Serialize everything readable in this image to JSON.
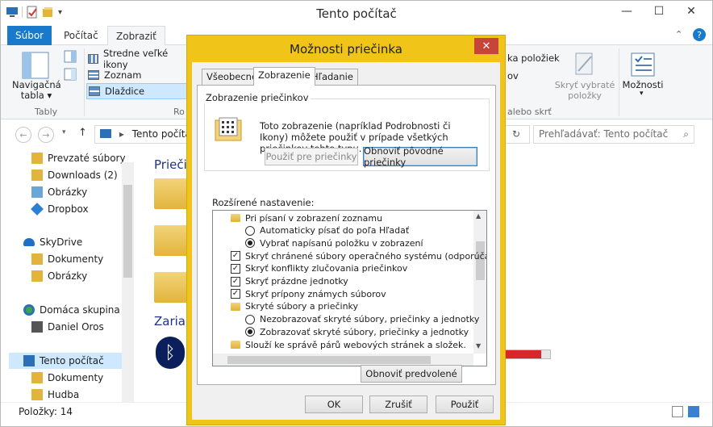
{
  "window": {
    "title": "Tento počítač",
    "tabs": {
      "file": "Súbor",
      "computer": "Počítač",
      "view": "Zobraziť"
    },
    "capbuttons": {
      "minimize": "—",
      "maximize": "☐",
      "close": "✕"
    }
  },
  "ribbon": {
    "layouts": [
      "Stredne veľké ikony",
      "Zoznam",
      "Dlaždice"
    ],
    "nav_pane_label": "Navigačná tabla ▾",
    "panes_group": "Tably",
    "layout_group_partial": "Ro",
    "right_partial1": "ka položiek",
    "right_partial2": "ov",
    "right_partial3": "alebo skrť",
    "hide_selected": "Skryť vybraté položky",
    "options": "Možnosti",
    "options_arrow": "▾",
    "help": "?",
    "chevron": "⌃"
  },
  "address": {
    "path": "Tento počítač",
    "search_placeholder": "Prehľadávať: Tento počítač"
  },
  "nav": {
    "items": [
      "Prevzaté súbory",
      "Downloads (2)",
      "Obrázky",
      "Dropbox",
      "SkyDrive",
      "Dokumenty",
      "Obrázky",
      "Domáca skupina",
      "Daniel Oros",
      "Tento počítač",
      "Dokumenty",
      "Hudba"
    ]
  },
  "content": {
    "folders_heading": "Priečin",
    "devices_heading": "Zariad"
  },
  "status": {
    "items": "Položky: 14"
  },
  "dialog": {
    "title": "Možnosti priečinka",
    "close": "✕",
    "tabs": [
      "Všeobecné",
      "Zobrazenie",
      "Hľadanie"
    ],
    "folder_views": {
      "title": "Zobrazenie priečinkov",
      "text": "Toto zobrazenie (napríklad Podrobnosti či Ikony) môžete použiť v prípade všetkých priečinkov tohto typu.",
      "apply_button": "Použiť pre priečinky",
      "reset_button": "Obnoviť pôvodné priečinky"
    },
    "advanced_label": "Rozšírené nastavenie:",
    "advanced_items": [
      {
        "kind": "folder",
        "text": "Pri písaní v zobrazení zoznamu",
        "indent": 0
      },
      {
        "kind": "radio",
        "checked": false,
        "text": "Automaticky písať do poľa Hľadať",
        "indent": 1
      },
      {
        "kind": "radio",
        "checked": true,
        "text": "Vybrať napísanú položku v zobrazení",
        "indent": 1
      },
      {
        "kind": "check",
        "checked": true,
        "text": "Skryť chránené súbory operačného systému (odporúča sa)",
        "indent": 0
      },
      {
        "kind": "check",
        "checked": true,
        "text": "Skryť konflikty zlučovania priečinkov",
        "indent": 0
      },
      {
        "kind": "check",
        "checked": true,
        "text": "Skryť prázdne jednotky",
        "indent": 0
      },
      {
        "kind": "check",
        "checked": true,
        "text": "Skryť prípony známych súborov",
        "indent": 0
      },
      {
        "kind": "folder",
        "text": "Skryté súbory a priečinky",
        "indent": 0
      },
      {
        "kind": "radio",
        "checked": false,
        "text": "Nezobrazovať skryté súbory, priečinky a jednotky",
        "indent": 1
      },
      {
        "kind": "radio",
        "checked": true,
        "text": "Zobrazovať skryté súbory, priečinky a jednotky",
        "indent": 1
      },
      {
        "kind": "folder",
        "text": "Slouží ke správě párů webových stránek a složek.",
        "indent": 0
      }
    ],
    "restore_defaults": "Obnoviť predvolené",
    "ok": "OK",
    "cancel": "Zrušiť",
    "apply": "Použiť",
    "scroll_up": "▲",
    "scroll_down": "▼",
    "checkmark": "✓"
  },
  "colors": {
    "dialog_frame": "#f0c419",
    "close_red": "#c7443a",
    "file_tab": "#1979ca",
    "selection": "#cde8ff"
  }
}
